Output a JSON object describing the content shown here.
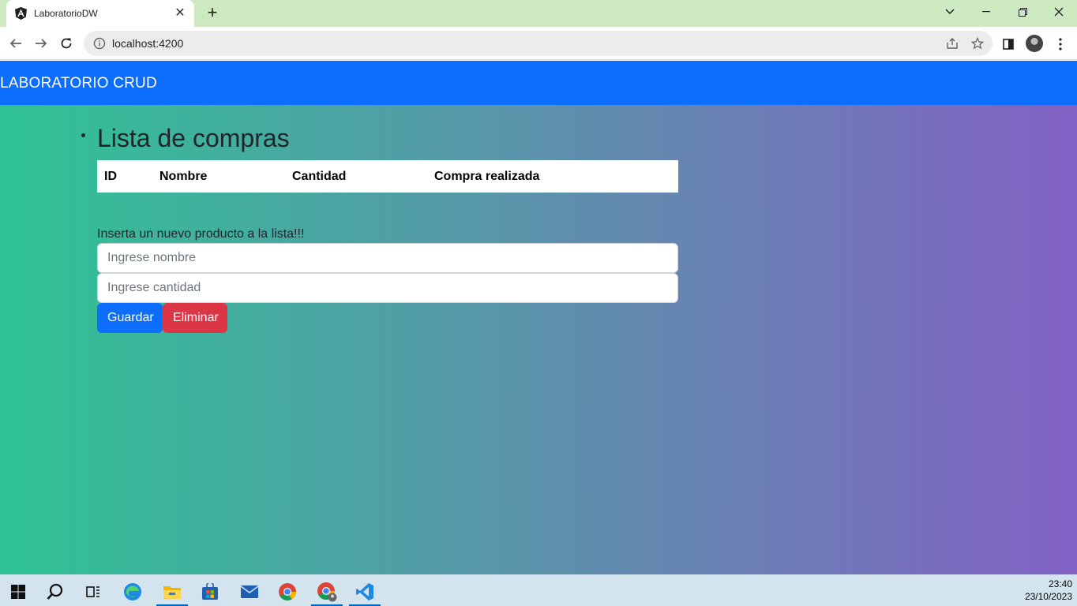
{
  "browser": {
    "tab_title": "LaboratorioDW",
    "url": "localhost:4200"
  },
  "navbar": {
    "brand": "LABORATORIO CRUD"
  },
  "main": {
    "list_title": "Lista de compras",
    "table_headers": [
      "ID",
      "Nombre",
      "Cantidad",
      "Compra realizada"
    ],
    "insert_label": "Inserta un nuevo producto a la lista!!!",
    "name_placeholder": "Ingrese nombre",
    "qty_placeholder": "Ingrese cantidad",
    "save_label": "Guardar",
    "delete_label": "Eliminar"
  },
  "taskbar": {
    "time": "23:40",
    "date": "23/10/2023"
  },
  "colors": {
    "navbar": "#0d6efd",
    "save": "#0d6efd",
    "delete": "#dc3545",
    "gradient_start": "#2fc394",
    "gradient_end": "#8261c4"
  }
}
